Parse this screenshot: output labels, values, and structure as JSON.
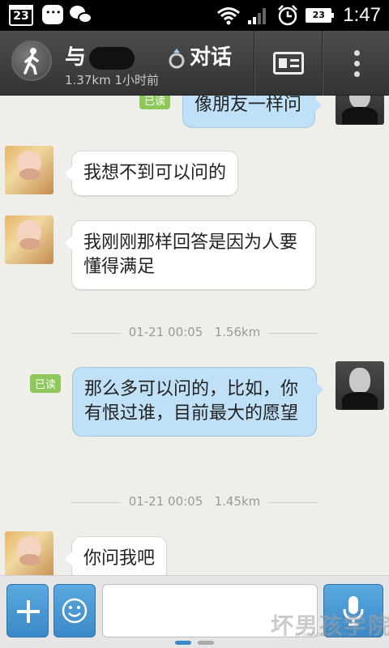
{
  "status_bar": {
    "calendar_day": "23",
    "battery_level": "23",
    "time": "1:47",
    "icons": [
      "calendar-icon",
      "chat-notification-icon",
      "wechat-icon",
      "wifi-icon",
      "signal-icon",
      "alarm-icon",
      "battery-icon"
    ]
  },
  "header": {
    "title_prefix": "与",
    "title_suffix": "对话",
    "subtitle": "1.37km 1小时前",
    "background": "#3d3d3d"
  },
  "messages": [
    {
      "side": "out",
      "text": "像朋友一样问",
      "read": "已读"
    },
    {
      "side": "in",
      "text": "我想不到可以问的"
    },
    {
      "side": "in",
      "text": "我刚刚那样回答是因为人要懂得满足"
    },
    {
      "side": "out",
      "text": "那么多可以问的，比如，你有恨过谁，目前最大的愿望",
      "read": "已读"
    },
    {
      "side": "in",
      "text": "你问我吧"
    }
  ],
  "timestamps": [
    {
      "date": "01-21 00:05",
      "distance": "1.56km"
    },
    {
      "date": "01-21 00:05",
      "distance": "1.45km"
    }
  ],
  "compose": {
    "placeholder": "",
    "watermark": "坏男孩学院",
    "watermark_url": "manhome.com",
    "accent": "#3b88c6",
    "outgoing_bubble": "#bfe0f7",
    "read_badge": "#8ec85a"
  }
}
